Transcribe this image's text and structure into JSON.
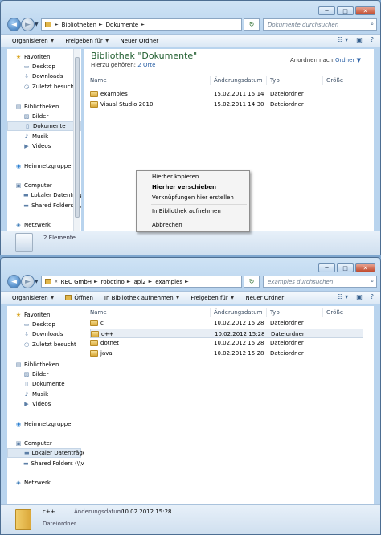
{
  "window1": {
    "caption_buttons": {
      "min": "─",
      "max": "□",
      "close": "✕"
    },
    "breadcrumb": [
      "Bibliotheken",
      "Dokumente"
    ],
    "search_placeholder": "Dokumente durchsuchen",
    "toolbar": [
      "Organisieren",
      "Freigeben für",
      "Neuer Ordner"
    ],
    "nav": [
      {
        "label": "Favoriten",
        "icon": "star-icon",
        "indent": 0,
        "selected": false
      },
      {
        "label": "Desktop",
        "icon": "desktop-icon",
        "indent": 1,
        "selected": false
      },
      {
        "label": "Downloads",
        "icon": "downloads-icon",
        "indent": 1,
        "selected": false
      },
      {
        "label": "Zuletzt besucht",
        "icon": "recent-places-icon",
        "indent": 1,
        "selected": false
      },
      {
        "label": "Bibliotheken",
        "icon": "libraries-icon",
        "indent": 0,
        "selected": false
      },
      {
        "label": "Bilder",
        "icon": "pictures-icon",
        "indent": 1,
        "selected": false
      },
      {
        "label": "Dokumente",
        "icon": "documents-icon",
        "indent": 1,
        "selected": true
      },
      {
        "label": "Musik",
        "icon": "music-icon",
        "indent": 1,
        "selected": false
      },
      {
        "label": "Videos",
        "icon": "videos-icon",
        "indent": 1,
        "selected": false
      },
      {
        "label": "Heimnetzgruppe",
        "icon": "homegroup-icon",
        "indent": 0,
        "selected": false
      },
      {
        "label": "Computer",
        "icon": "computer-icon",
        "indent": 0,
        "selected": false
      },
      {
        "label": "Lokaler Datenträg",
        "icon": "local-drive-icon",
        "indent": 1,
        "selected": false
      },
      {
        "label": "Shared Folders (\\\\",
        "icon": "network-drive-icon",
        "indent": 1,
        "selected": false
      },
      {
        "label": "Netzwerk",
        "icon": "network-icon",
        "indent": 0,
        "selected": false
      }
    ],
    "library_title": "Bibliothek \"Dokumente\"",
    "library_sub_prefix": "Hierzu gehören:",
    "library_sub_link": "2 Orte",
    "arrange_label": "Anordnen nach:",
    "arrange_value": "Ordner",
    "columns": [
      "Name",
      "Änderungsdatum",
      "Typ",
      "Größe"
    ],
    "rows": [
      {
        "name": "examples",
        "date": "15.02.2011 15:14",
        "type": "Dateiordner"
      },
      {
        "name": "Visual Studio 2010",
        "date": "15.02.2011 14:30",
        "type": "Dateiordner"
      }
    ],
    "status_text": "2 Elemente"
  },
  "context_menu": {
    "items": [
      "Hierher kopieren",
      "Hierher verschieben",
      "Verknüpfungen hier erstellen",
      "In Bibliothek aufnehmen",
      "Abbrechen"
    ],
    "bold_index": 1
  },
  "window2": {
    "caption_buttons": {
      "min": "─",
      "max": "□",
      "close": "✕"
    },
    "breadcrumb": [
      "REC GmbH",
      "robotino",
      "api2",
      "examples"
    ],
    "search_placeholder": "examples durchsuchen",
    "toolbar": [
      "Organisieren",
      "Öffnen",
      "In Bibliothek aufnehmen",
      "Freigeben für",
      "Neuer Ordner"
    ],
    "nav": [
      {
        "label": "Favoriten",
        "icon": "star-icon",
        "indent": 0,
        "selected": false
      },
      {
        "label": "Desktop",
        "icon": "desktop-icon",
        "indent": 1,
        "selected": false
      },
      {
        "label": "Downloads",
        "icon": "downloads-icon",
        "indent": 1,
        "selected": false
      },
      {
        "label": "Zuletzt besucht",
        "icon": "recent-places-icon",
        "indent": 1,
        "selected": false
      },
      {
        "label": "Bibliotheken",
        "icon": "libraries-icon",
        "indent": 0,
        "selected": false
      },
      {
        "label": "Bilder",
        "icon": "pictures-icon",
        "indent": 1,
        "selected": false
      },
      {
        "label": "Dokumente",
        "icon": "documents-icon",
        "indent": 1,
        "selected": false
      },
      {
        "label": "Musik",
        "icon": "music-icon",
        "indent": 1,
        "selected": false
      },
      {
        "label": "Videos",
        "icon": "videos-icon",
        "indent": 1,
        "selected": false
      },
      {
        "label": "Heimnetzgruppe",
        "icon": "homegroup-icon",
        "indent": 0,
        "selected": false
      },
      {
        "label": "Computer",
        "icon": "computer-icon",
        "indent": 0,
        "selected": false
      },
      {
        "label": "Lokaler Datenträger",
        "icon": "local-drive-icon",
        "indent": 1,
        "selected": true
      },
      {
        "label": "Shared Folders (\\\\vm",
        "icon": "network-drive-icon",
        "indent": 1,
        "selected": false
      },
      {
        "label": "Netzwerk",
        "icon": "network-icon",
        "indent": 0,
        "selected": false
      }
    ],
    "columns": [
      "Name",
      "Änderungsdatum",
      "Typ",
      "Größe"
    ],
    "rows": [
      {
        "name": "c",
        "date": "10.02.2012 15:28",
        "type": "Dateiordner",
        "selected": false
      },
      {
        "name": "c++",
        "date": "10.02.2012 15:28",
        "type": "Dateiordner",
        "selected": true
      },
      {
        "name": "dotnet",
        "date": "10.02.2012 15:28",
        "type": "Dateiordner",
        "selected": false
      },
      {
        "name": "java",
        "date": "10.02.2012 15:28",
        "type": "Dateiordner",
        "selected": false
      }
    ],
    "details": {
      "name": "c++",
      "date_label": "Änderungsdatum:",
      "date_value": "10.02.2012 15:28",
      "type": "Dateiordner"
    }
  }
}
